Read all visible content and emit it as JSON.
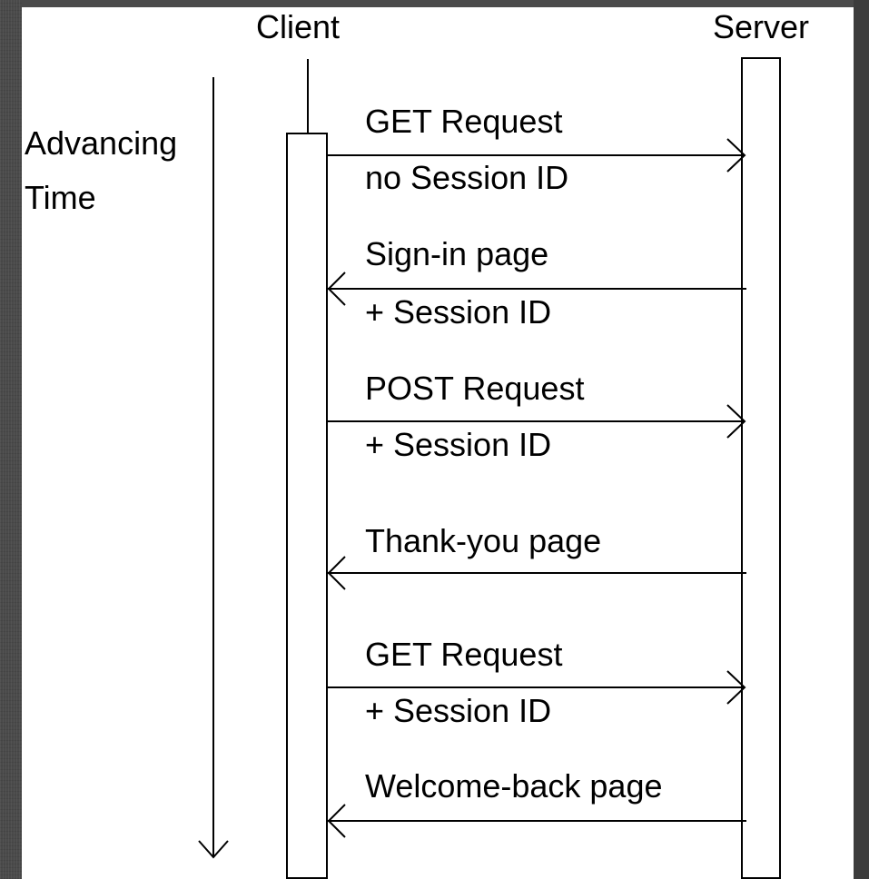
{
  "participants": {
    "client": "Client",
    "server": "Server"
  },
  "time_axis": {
    "line1": "Advancing",
    "line2": "Time"
  },
  "messages": [
    {
      "direction": "to-server",
      "line1": "GET Request",
      "line2": "no Session ID"
    },
    {
      "direction": "to-client",
      "line1": "Sign-in page",
      "line2": "+ Session ID"
    },
    {
      "direction": "to-server",
      "line1": "POST Request",
      "line2": "+ Session ID"
    },
    {
      "direction": "to-client",
      "line1": "Thank-you page",
      "line2": ""
    },
    {
      "direction": "to-server",
      "line1": "GET Request",
      "line2": "+ Session ID"
    },
    {
      "direction": "to-client",
      "line1": "Welcome-back page",
      "line2": ""
    }
  ]
}
